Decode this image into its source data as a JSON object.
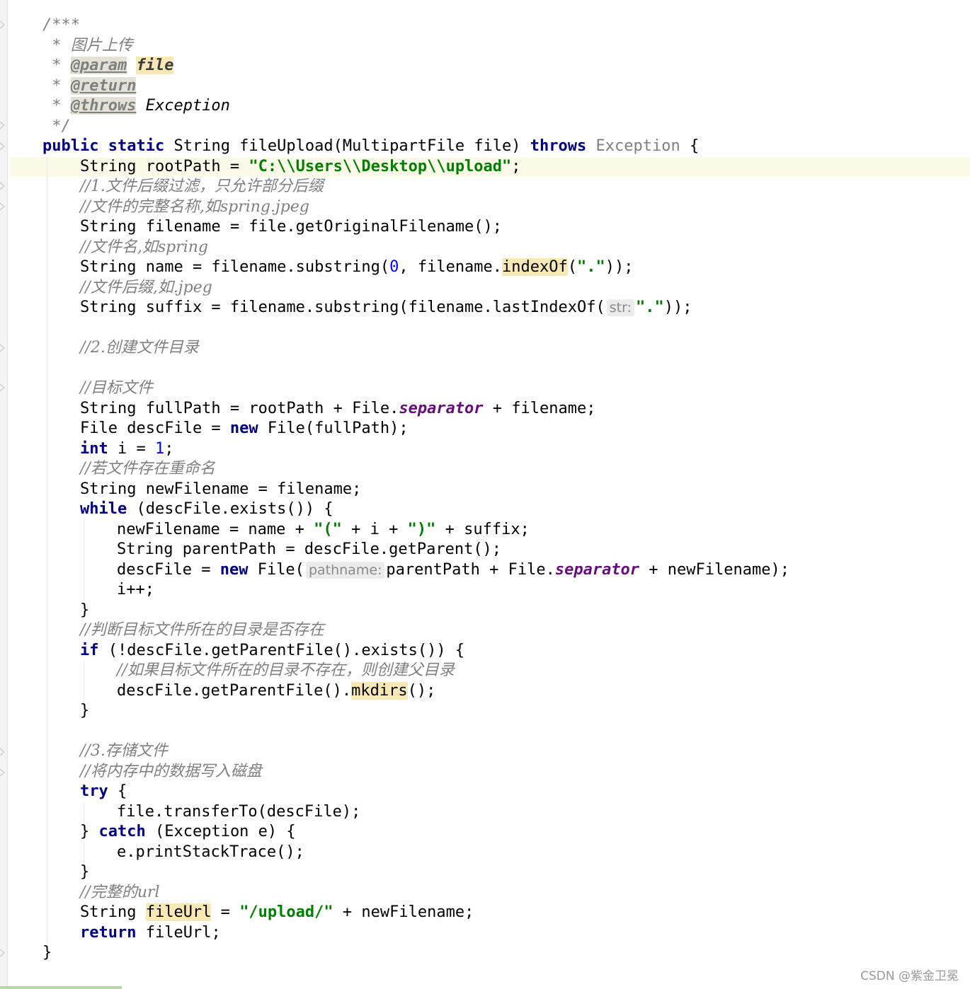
{
  "code": {
    "doc": {
      "open": "/***",
      "desc_star": " * ",
      "desc": "图片上传",
      "param_star": " * ",
      "param_tag": "@param",
      "param_name": "file",
      "return_star": " * ",
      "return_tag": "@return",
      "throws_star": " * ",
      "throws_tag": "@throws",
      "throws_ref": "Exception",
      "close": " */"
    },
    "signature": {
      "mod1": "public",
      "mod2": "static",
      "rest": "String fileUpload(MultipartFile file) ",
      "throws_kw": "throws",
      "exception": "Exception",
      "brace": " {"
    },
    "l_rootpath": {
      "a": "String rootPath = ",
      "s": "\"C:\\\\Users\\\\Desktop\\\\upload\"",
      "b": ";"
    },
    "c1": "//1.文件后缀过滤，只允许部分后缀",
    "c2": "//文件的完整名称,如spring.jpeg",
    "l_filename": "String filename = file.getOriginalFilename();",
    "c3": "//文件名,如spring",
    "l_name": {
      "a": "String name = filename.substring(",
      "n": "0",
      "b": ", filename.",
      "m": "indexOf",
      "c": "(",
      "s": "\".\"",
      "d": "));"
    },
    "c4": "//文件后缀,如.jpeg",
    "l_suffix": {
      "a": "String suffix = filename.substring(filename.lastIndexOf(",
      "hint": "str:",
      "s": "\".\"",
      "b": "));"
    },
    "c5": "//2.创建文件目录",
    "c6": "//目标文件",
    "l_fullpath": {
      "a": "String fullPath = rootPath + File.",
      "f": "separator",
      "b": " + filename;"
    },
    "l_descfile": {
      "a": "File descFile = ",
      "k": "new",
      "b": " File(fullPath);"
    },
    "l_int": {
      "k": "int",
      "a": " i = ",
      "n": "1",
      "b": ";"
    },
    "c7": "//若文件存在重命名",
    "l_newfn": "String newFilename = filename;",
    "l_while": {
      "k": "while",
      "a": " (descFile.exists()) {"
    },
    "l_w1": {
      "a": "newFilename = name + ",
      "s1": "\"(\"",
      "b": " + i + ",
      "s2": "\")\"",
      "c": " + suffix;"
    },
    "l_w2": "String parentPath = descFile.getParent();",
    "l_w3": {
      "a": "descFile = ",
      "k": "new",
      "b": " File(",
      "hint": "pathname:",
      "c": "parentPath + File.",
      "f": "separator",
      "d": " + newFilename);"
    },
    "l_w4": "i++;",
    "close_brace": "}",
    "c8": "//判断目标文件所在的目录是否存在",
    "l_if": {
      "k": "if",
      "a": " (!descFile.getParentFile().exists()) {"
    },
    "c9": "//如果目标文件所在的目录不存在，则创建父目录",
    "l_mkdirs": {
      "a": "descFile.getParentFile().",
      "m": "mkdirs",
      "b": "();"
    },
    "c10": "//3.存储文件",
    "c11": "//将内存中的数据写入磁盘",
    "l_try": {
      "k": "try",
      "a": " {"
    },
    "l_transfer": "file.transferTo(descFile);",
    "l_catch": {
      "a": "} ",
      "k": "catch",
      "b": " (Exception e) {"
    },
    "l_print": "e.printStackTrace();",
    "c12": "//完整的url",
    "l_fileurl": {
      "a": "String ",
      "v": "fileUrl",
      "b": " = ",
      "s": "\"/upload/\"",
      "c": " + newFilename;"
    },
    "l_return": {
      "k": "return",
      "a": " fileUrl;"
    }
  },
  "watermark": "CSDN @紫金卫冕",
  "icons": {
    "intention": "lightbulb-icon",
    "fold": "fold-marker-icon"
  }
}
